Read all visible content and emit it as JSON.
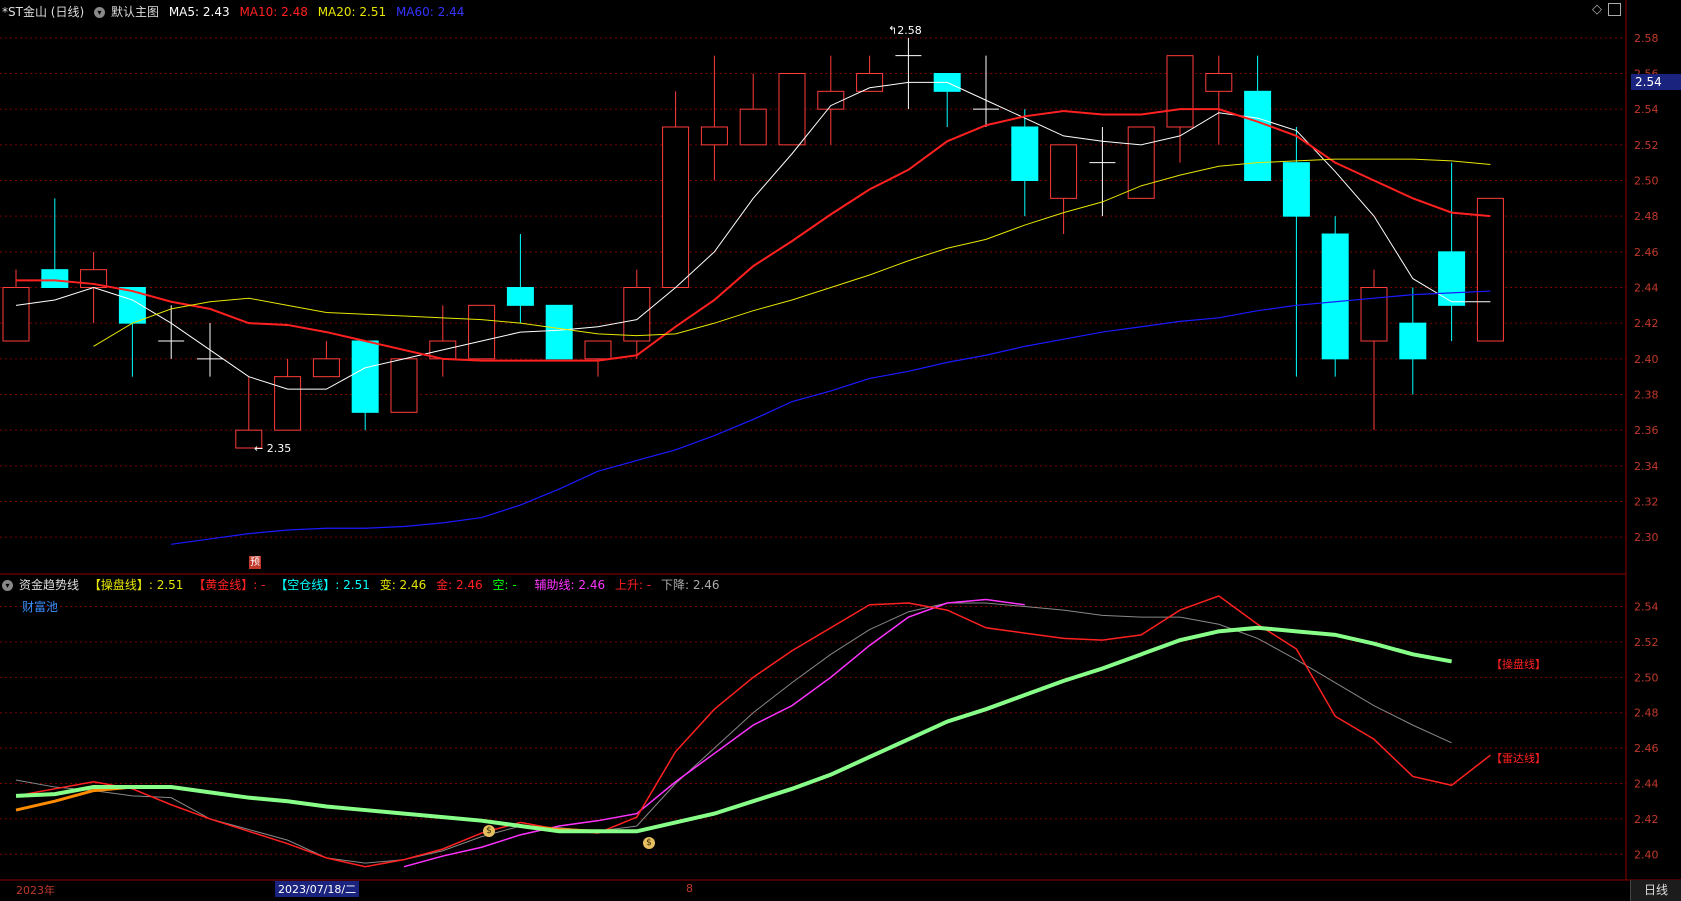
{
  "header": {
    "stock": "*ST金山 (日线)",
    "template": "默认主图",
    "ma5_label": "MA5:",
    "ma5_value": "2.43",
    "ma10_label": "MA10:",
    "ma10_value": "2.48",
    "ma20_label": "MA20:",
    "ma20_value": "2.51",
    "ma60_label": "MA60:",
    "ma60_value": "2.44"
  },
  "indicator_header": {
    "name": "资金趋势线",
    "cao": "【操盘线】: 2.51",
    "huang": "【黄金线】: -",
    "kong": "【空仓线】: 2.51",
    "bian": "变: 2.46",
    "jin": "金: 2.46",
    "kongshort": "空: -",
    "fuzhu": "辅助线: 2.46",
    "shang": "上升: -",
    "xia": "下降: 2.46",
    "caifu": "财富池"
  },
  "labels": {
    "high": "2.58",
    "low": "2.35",
    "yu": "预",
    "cao_line": "【操盘线】",
    "leida_line": "【雷达线】",
    "current_price": "2.54",
    "x_start": "2023年",
    "x_selected": "2023/07/18/二",
    "x_month": "8",
    "period": "日线"
  },
  "colors": {
    "up": "#ff3b3b",
    "down": "#00ffff",
    "ma5": "#ffffff",
    "ma10": "#ff2020",
    "ma20": "#e6e600",
    "ma60": "#1a1aff",
    "grid": "#7a0000",
    "axis_text": "#c0392b"
  },
  "chart_data": [
    {
      "type": "candlestick",
      "title": "*ST金山 (日线)",
      "y_ticks": [
        "2.58",
        "2.56",
        "2.54",
        "2.52",
        "2.50",
        "2.48",
        "2.46",
        "2.44",
        "2.42",
        "2.40",
        "2.38",
        "2.36",
        "2.34",
        "2.32",
        "2.30"
      ],
      "ylim": [
        2.29,
        2.59
      ],
      "candles": [
        {
          "o": 2.41,
          "h": 2.45,
          "l": 2.41,
          "c": 2.44
        },
        {
          "o": 2.45,
          "h": 2.49,
          "l": 2.44,
          "c": 2.44
        },
        {
          "o": 2.44,
          "h": 2.46,
          "l": 2.42,
          "c": 2.45
        },
        {
          "o": 2.44,
          "h": 2.44,
          "l": 2.39,
          "c": 2.42
        },
        {
          "o": 2.41,
          "h": 2.43,
          "l": 2.4,
          "c": 2.41
        },
        {
          "o": 2.4,
          "h": 2.42,
          "l": 2.39,
          "c": 2.4
        },
        {
          "o": 2.35,
          "h": 2.39,
          "l": 2.35,
          "c": 2.36
        },
        {
          "o": 2.36,
          "h": 2.4,
          "l": 2.36,
          "c": 2.39
        },
        {
          "o": 2.39,
          "h": 2.41,
          "l": 2.39,
          "c": 2.4
        },
        {
          "o": 2.41,
          "h": 2.41,
          "l": 2.36,
          "c": 2.37
        },
        {
          "o": 2.37,
          "h": 2.4,
          "l": 2.37,
          "c": 2.4
        },
        {
          "o": 2.4,
          "h": 2.43,
          "l": 2.39,
          "c": 2.41
        },
        {
          "o": 2.4,
          "h": 2.43,
          "l": 2.4,
          "c": 2.43
        },
        {
          "o": 2.44,
          "h": 2.47,
          "l": 2.42,
          "c": 2.43
        },
        {
          "o": 2.43,
          "h": 2.43,
          "l": 2.4,
          "c": 2.4
        },
        {
          "o": 2.4,
          "h": 2.41,
          "l": 2.39,
          "c": 2.41
        },
        {
          "o": 2.41,
          "h": 2.45,
          "l": 2.4,
          "c": 2.44
        },
        {
          "o": 2.44,
          "h": 2.55,
          "l": 2.44,
          "c": 2.53
        },
        {
          "o": 2.52,
          "h": 2.57,
          "l": 2.5,
          "c": 2.53
        },
        {
          "o": 2.52,
          "h": 2.56,
          "l": 2.52,
          "c": 2.54
        },
        {
          "o": 2.52,
          "h": 2.56,
          "l": 2.52,
          "c": 2.56
        },
        {
          "o": 2.54,
          "h": 2.57,
          "l": 2.52,
          "c": 2.55
        },
        {
          "o": 2.55,
          "h": 2.57,
          "l": 2.55,
          "c": 2.56
        },
        {
          "o": 2.57,
          "h": 2.58,
          "l": 2.54,
          "c": 2.57
        },
        {
          "o": 2.56,
          "h": 2.56,
          "l": 2.53,
          "c": 2.55
        },
        {
          "o": 2.54,
          "h": 2.57,
          "l": 2.53,
          "c": 2.54
        },
        {
          "o": 2.53,
          "h": 2.54,
          "l": 2.48,
          "c": 2.5
        },
        {
          "o": 2.49,
          "h": 2.52,
          "l": 2.47,
          "c": 2.52
        },
        {
          "o": 2.51,
          "h": 2.53,
          "l": 2.48,
          "c": 2.51
        },
        {
          "o": 2.49,
          "h": 2.53,
          "l": 2.49,
          "c": 2.53
        },
        {
          "o": 2.53,
          "h": 2.57,
          "l": 2.51,
          "c": 2.57
        },
        {
          "o": 2.55,
          "h": 2.57,
          "l": 2.52,
          "c": 2.56
        },
        {
          "o": 2.55,
          "h": 2.57,
          "l": 2.5,
          "c": 2.5
        },
        {
          "o": 2.51,
          "h": 2.53,
          "l": 2.39,
          "c": 2.48
        },
        {
          "o": 2.47,
          "h": 2.48,
          "l": 2.39,
          "c": 2.4
        },
        {
          "o": 2.41,
          "h": 2.45,
          "l": 2.36,
          "c": 2.44
        },
        {
          "o": 2.42,
          "h": 2.44,
          "l": 2.38,
          "c": 2.4
        },
        {
          "o": 2.46,
          "h": 2.51,
          "l": 2.41,
          "c": 2.43
        },
        {
          "o": 2.41,
          "h": 2.49,
          "l": 2.41,
          "c": 2.49
        }
      ],
      "series": [
        {
          "name": "MA5",
          "values": [
            2.43,
            2.433,
            2.44,
            2.433,
            2.42,
            2.405,
            2.39,
            2.383,
            2.383,
            2.395,
            2.4,
            2.405,
            2.41,
            2.415,
            2.416,
            2.418,
            2.422,
            2.44,
            2.46,
            2.49,
            2.515,
            2.542,
            2.552,
            2.555,
            2.555,
            2.545,
            2.535,
            2.525,
            2.522,
            2.52,
            2.525,
            2.538,
            2.535,
            2.528,
            2.505,
            2.48,
            2.445,
            2.432,
            2.432
          ]
        },
        {
          "name": "MA10",
          "values": [
            2.444,
            2.444,
            2.442,
            2.438,
            2.432,
            2.428,
            2.42,
            2.419,
            2.415,
            2.41,
            2.405,
            2.4,
            2.399,
            2.399,
            2.399,
            2.399,
            2.402,
            2.418,
            2.433,
            2.452,
            2.466,
            2.481,
            2.495,
            2.506,
            2.522,
            2.531,
            2.536,
            2.539,
            2.537,
            2.537,
            2.54,
            2.54,
            2.533,
            2.525,
            2.51,
            2.5,
            2.49,
            2.482,
            2.48
          ]
        },
        {
          "name": "MA20",
          "values": [
            2.407,
            2.42,
            2.428,
            2.432,
            2.434,
            2.43,
            2.426,
            2.425,
            2.424,
            2.423,
            2.422,
            2.42,
            2.417,
            2.414,
            2.413,
            2.414,
            2.42,
            2.427,
            2.433,
            2.44,
            2.447,
            2.455,
            2.462,
            2.467,
            2.475,
            2.482,
            2.488,
            2.497,
            2.503,
            2.508,
            2.51,
            2.511,
            2.512,
            2.512,
            2.512,
            2.511,
            2.509
          ]
        },
        {
          "name": "MA60",
          "values": [
            2.296,
            2.299,
            2.302,
            2.304,
            2.305,
            2.305,
            2.306,
            2.308,
            2.311,
            2.318,
            2.327,
            2.337,
            2.343,
            2.349,
            2.357,
            2.366,
            2.376,
            2.382,
            2.389,
            2.393,
            2.398,
            2.402,
            2.407,
            2.411,
            2.415,
            2.418,
            2.421,
            2.423,
            2.427,
            2.43,
            2.432,
            2.434,
            2.436,
            2.437,
            2.438
          ]
        }
      ]
    },
    {
      "type": "line",
      "title": "资金趋势线",
      "y_ticks": [
        "2.54",
        "2.52",
        "2.50",
        "2.48",
        "2.46",
        "2.44",
        "2.42",
        "2.40"
      ],
      "ylim": [
        2.39,
        2.555
      ],
      "series": [
        {
          "name": "操盘线",
          "values": [
            2.433,
            2.434,
            2.438,
            2.438,
            2.438,
            2.435,
            2.432,
            2.43,
            2.427,
            2.425,
            2.423,
            2.421,
            2.419,
            2.416,
            2.413,
            2.413,
            2.413,
            2.418,
            2.423,
            2.43,
            2.437,
            2.445,
            2.455,
            2.465,
            2.475,
            2.482,
            2.49,
            2.498,
            2.505,
            2.513,
            2.521,
            2.526,
            2.528,
            2.526,
            2.524,
            2.519,
            2.513,
            2.509
          ]
        },
        {
          "name": "空仓线",
          "values": [
            2.425,
            2.43,
            2.436,
            2.438,
            2.438,
            2.435,
            2.432,
            2.43,
            2.427,
            2.425,
            2.423,
            2.421,
            2.419,
            2.416,
            2.414,
            2.413,
            2.413,
            2.418,
            2.423,
            2.43,
            2.437,
            2.445,
            2.455,
            2.465,
            2.475,
            2.482,
            2.49,
            2.498,
            2.505,
            2.513,
            2.521,
            2.526,
            2.528,
            2.526,
            2.524,
            2.519,
            2.513,
            2.509
          ]
        },
        {
          "name": "黄金线",
          "values": [
            2.433,
            2.437,
            2.441,
            2.437,
            2.428,
            2.42,
            2.413,
            2.406,
            2.398,
            2.393,
            2.397,
            2.403,
            2.412,
            2.418,
            2.414,
            2.412,
            2.421,
            2.458,
            2.482,
            2.5,
            2.515,
            2.528,
            2.541,
            2.542,
            2.538,
            2.528,
            2.525,
            2.522,
            2.521,
            2.524,
            2.538,
            2.546,
            2.53,
            2.516,
            2.478,
            2.465,
            2.444,
            2.439,
            2.456
          ]
        },
        {
          "name": "辅助线",
          "values": [
            null,
            null,
            null,
            null,
            null,
            null,
            null,
            null,
            null,
            null,
            2.393,
            2.399,
            2.404,
            2.411,
            2.416,
            2.419,
            2.423,
            2.441,
            2.457,
            2.473,
            2.484,
            2.5,
            2.518,
            2.534,
            2.542,
            2.544,
            2.541
          ]
        },
        {
          "name": "下降",
          "values": [
            2.442,
            2.438,
            2.436,
            2.433,
            2.432,
            2.42,
            2.414,
            2.408,
            2.398,
            2.395,
            2.397,
            2.402,
            2.41,
            2.416,
            2.415,
            2.413,
            2.416,
            2.44,
            2.46,
            2.48,
            2.497,
            2.513,
            2.527,
            2.537,
            2.542,
            2.542,
            2.54,
            2.538,
            2.535,
            2.534,
            2.534,
            2.53,
            2.522,
            2.51,
            2.497,
            2.484,
            2.473,
            2.463
          ]
        }
      ]
    }
  ]
}
